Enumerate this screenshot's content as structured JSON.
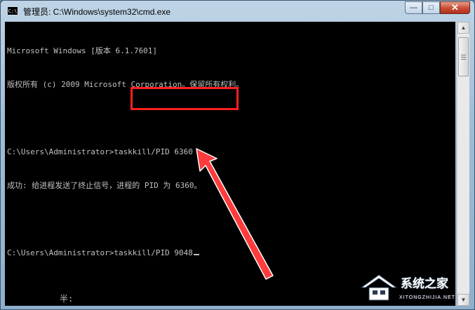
{
  "window": {
    "title": "管理员: C:\\Windows\\system32\\cmd.exe",
    "icon_text": "C:\\",
    "icons": {
      "app": "cmd-icon",
      "minimize": "minimize-icon",
      "maximize": "maximize-icon",
      "close": "close-icon"
    },
    "minimize_glyph": "—",
    "maximize_glyph": "□",
    "close_glyph": "✕"
  },
  "console": {
    "lines": [
      "Microsoft Windows [版本 6.1.7601]",
      "版权所有 (c) 2009 Microsoft Corporation。保留所有权利。",
      "",
      "C:\\Users\\Administrator>taskkill/PID 6360",
      "成功: 给进程发送了终止信号，进程的 PID 为 6360。",
      "",
      "C:\\Users\\Administrator>taskkill/PID 9048"
    ],
    "text_color": "#c0c0c0",
    "background": "#000000"
  },
  "ime_status": "半:",
  "scrollbar": {
    "up_glyph": "▲",
    "down_glyph": "▼"
  },
  "annotation": {
    "highlight_color": "#ff2020",
    "arrow_color": "#ff3b3b"
  },
  "watermark": {
    "name": "系统之家",
    "url": "XITONGZHIJIA.NET"
  }
}
